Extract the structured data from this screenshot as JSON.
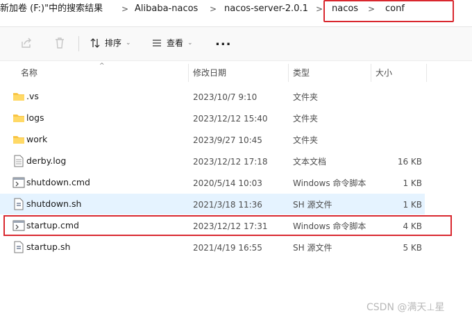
{
  "breadcrumb": {
    "items": [
      "新加卷 (F:)\"中的搜索结果",
      "Alibaba-nacos",
      "nacos-server-2.0.1",
      "nacos",
      "conf"
    ],
    "separator": ">"
  },
  "toolbar": {
    "sort_label": "排序",
    "view_label": "查看",
    "more_label": "..."
  },
  "columns": {
    "name": "名称",
    "date": "修改日期",
    "type": "类型",
    "size": "大小"
  },
  "files": [
    {
      "name": ".vs",
      "date": "2023/10/7 9:10",
      "type": "文件夹",
      "size": "",
      "icon": "folder-icon"
    },
    {
      "name": "logs",
      "date": "2023/12/12 15:40",
      "type": "文件夹",
      "size": "",
      "icon": "folder-icon"
    },
    {
      "name": "work",
      "date": "2023/9/27 10:45",
      "type": "文件夹",
      "size": "",
      "icon": "folder-icon"
    },
    {
      "name": "derby.log",
      "date": "2023/12/12 17:18",
      "type": "文本文档",
      "size": "16 KB",
      "icon": "text-file-icon"
    },
    {
      "name": "shutdown.cmd",
      "date": "2020/5/14 10:03",
      "type": "Windows 命令脚本",
      "size": "1 KB",
      "icon": "cmd-script-icon"
    },
    {
      "name": "shutdown.sh",
      "date": "2021/3/18 11:36",
      "type": "SH 源文件",
      "size": "1 KB",
      "icon": "sh-file-icon"
    },
    {
      "name": "startup.cmd",
      "date": "2023/12/12 17:31",
      "type": "Windows 命令脚本",
      "size": "4 KB",
      "icon": "cmd-script-icon"
    },
    {
      "name": "startup.sh",
      "date": "2021/4/19 16:55",
      "type": "SH 源文件",
      "size": "5 KB",
      "icon": "sh-file-icon"
    }
  ],
  "selected_row": "shutdown.sh",
  "highlight_color": "#d9272e",
  "watermark": "CSDN @满天⊥星"
}
